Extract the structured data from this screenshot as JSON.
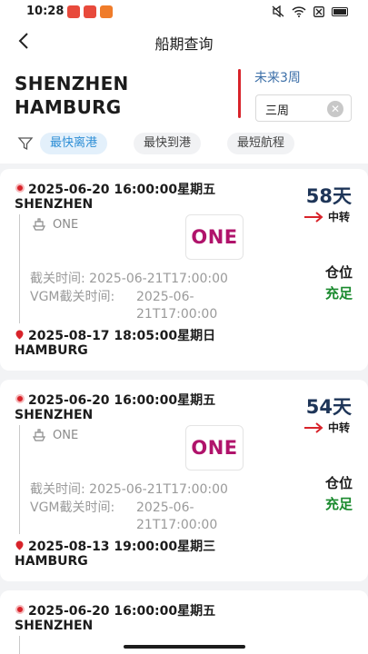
{
  "status_bar": {
    "time": "10:28"
  },
  "header": {
    "title": "船期查询"
  },
  "route": {
    "origin": "SHENZHEN",
    "destination": "HAMBURG",
    "period_label": "未来3周",
    "period_value": "三周"
  },
  "filters": [
    "最快离港",
    "最快到港",
    "最短航程"
  ],
  "colors": {
    "accent": "#2f8fd6",
    "brand_red": "#d8232a",
    "days": "#1e3558",
    "ok_green": "#1a8a2e",
    "carrier": "#b0136b"
  },
  "cards": [
    {
      "departure": "2025-06-20 16:00:00星期五",
      "pol": "SHENZHEN",
      "days": "58天",
      "transit": "中转",
      "carrier": "ONE",
      "carrier_logo": "ONE",
      "cutoff": "截关时间: 2025-06-21T17:00:00",
      "vgm_label": "VGM截关时间:",
      "vgm_value": "2025-06-21T17:00:00",
      "space_label": "仓位",
      "space_value": "充足",
      "arrival": "2025-08-17 18:05:00星期日",
      "pod": "HAMBURG"
    },
    {
      "departure": "2025-06-20 16:00:00星期五",
      "pol": "SHENZHEN",
      "days": "54天",
      "transit": "中转",
      "carrier": "ONE",
      "carrier_logo": "ONE",
      "cutoff": "截关时间: 2025-06-21T17:00:00",
      "vgm_label": "VGM截关时间:",
      "vgm_value": "2025-06-21T17:00:00",
      "space_label": "仓位",
      "space_value": "充足",
      "arrival": "2025-08-13 19:00:00星期三",
      "pod": "HAMBURG"
    },
    {
      "departure": "2025-06-20 16:00:00星期五",
      "pol": "SHENZHEN"
    }
  ]
}
